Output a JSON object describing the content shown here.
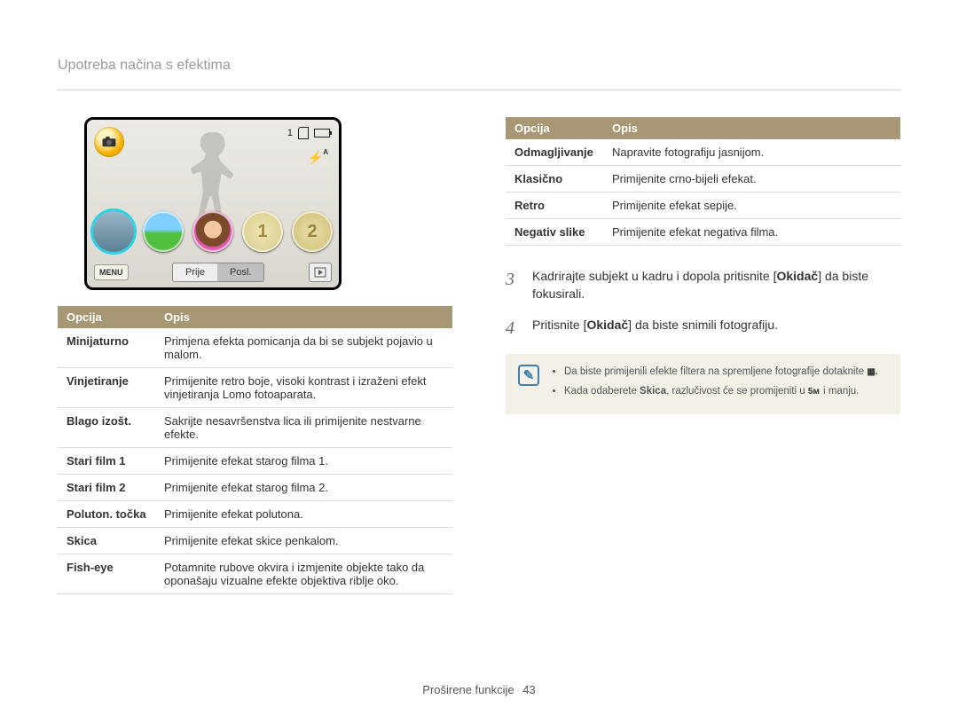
{
  "page_title": "Upotreba načina s efektima",
  "camera": {
    "count": "1",
    "flash": "ᴬ",
    "menu": "MENU",
    "before": "Prije",
    "after": "Posl.",
    "thumb3": "1",
    "thumb4": "2"
  },
  "table_headers": {
    "option": "Opcija",
    "desc": "Opis"
  },
  "left_table": [
    {
      "option": "Minijaturno",
      "desc": "Primjena efekta pomicanja da bi se subjekt pojavio u malom."
    },
    {
      "option": "Vinjetiranje",
      "desc": "Primijenite retro boje, visoki kontrast i izraženi efekt vinjetiranja Lomo fotoaparata."
    },
    {
      "option": "Blago izošt.",
      "desc": "Sakrijte nesavršenstva lica ili primijenite nestvarne efekte."
    },
    {
      "option": "Stari film 1",
      "desc": "Primijenite efekat starog filma 1."
    },
    {
      "option": "Stari film 2",
      "desc": "Primijenite efekat starog filma 2."
    },
    {
      "option": "Poluton. točka",
      "desc": "Primijenite efekat polutona."
    },
    {
      "option": "Skica",
      "desc": "Primijenite efekat skice penkalom."
    },
    {
      "option": "Fish-eye",
      "desc": "Potamnite rubove okvira i izmjenite objekte tako da oponašaju vizualne efekte objektiva riblje oko."
    }
  ],
  "right_table": [
    {
      "option": "Odmagljivanje",
      "desc": "Napravite fotografiju jasnijom."
    },
    {
      "option": "Klasično",
      "desc": "Primijenite crno-bijeli efekat."
    },
    {
      "option": "Retro",
      "desc": "Primijenite efekat sepije."
    },
    {
      "option": "Negativ slike",
      "desc": "Primijenite efekat negativa filma."
    }
  ],
  "steps": {
    "s3_num": "3",
    "s3_a": "Kadrirajte subjekt u kadru i dopola pritisnite [",
    "s3_b": "Okidač",
    "s3_c": "] da biste fokusirali.",
    "s4_num": "4",
    "s4_a": "Pritisnite [",
    "s4_b": "Okidač",
    "s4_c": "] da biste snimili fotografiju."
  },
  "notes": {
    "n1": "Da biste primijenili efekte filtera na spremljene fotografije dotaknite ",
    "n1_glyph": "▦.",
    "n2a": "Kada odaberete ",
    "n2b": "Skica",
    "n2c": ", razlučivost će se promijeniti u ",
    "n2_glyph": "5ᴍ",
    "n2d": " i manju."
  },
  "footer": {
    "section": "Proširene funkcije",
    "page": "43"
  }
}
